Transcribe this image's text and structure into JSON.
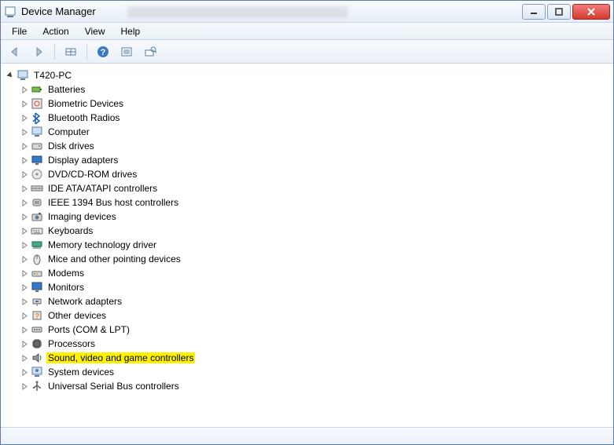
{
  "window": {
    "title": "Device Manager"
  },
  "menus": {
    "file": "File",
    "action": "Action",
    "view": "View",
    "help": "Help"
  },
  "root": {
    "label": "T420-PC"
  },
  "categories": [
    {
      "label": "Batteries",
      "icon": "battery",
      "highlighted": false
    },
    {
      "label": "Biometric Devices",
      "icon": "biometric",
      "highlighted": false
    },
    {
      "label": "Bluetooth Radios",
      "icon": "bluetooth",
      "highlighted": false
    },
    {
      "label": "Computer",
      "icon": "computer",
      "highlighted": false
    },
    {
      "label": "Disk drives",
      "icon": "disk",
      "highlighted": false
    },
    {
      "label": "Display adapters",
      "icon": "display",
      "highlighted": false
    },
    {
      "label": "DVD/CD-ROM drives",
      "icon": "dvd",
      "highlighted": false
    },
    {
      "label": "IDE ATA/ATAPI controllers",
      "icon": "ide",
      "highlighted": false
    },
    {
      "label": "IEEE 1394 Bus host controllers",
      "icon": "ieee1394",
      "highlighted": false
    },
    {
      "label": "Imaging devices",
      "icon": "imaging",
      "highlighted": false
    },
    {
      "label": "Keyboards",
      "icon": "keyboard",
      "highlighted": false
    },
    {
      "label": "Memory technology driver",
      "icon": "memory",
      "highlighted": false
    },
    {
      "label": "Mice and other pointing devices",
      "icon": "mouse",
      "highlighted": false
    },
    {
      "label": "Modems",
      "icon": "modem",
      "highlighted": false
    },
    {
      "label": "Monitors",
      "icon": "monitor",
      "highlighted": false
    },
    {
      "label": "Network adapters",
      "icon": "network",
      "highlighted": false
    },
    {
      "label": "Other devices",
      "icon": "other",
      "highlighted": false
    },
    {
      "label": "Ports (COM & LPT)",
      "icon": "port",
      "highlighted": false
    },
    {
      "label": "Processors",
      "icon": "cpu",
      "highlighted": false
    },
    {
      "label": "Sound, video and game controllers",
      "icon": "sound",
      "highlighted": true
    },
    {
      "label": "System devices",
      "icon": "system",
      "highlighted": false
    },
    {
      "label": "Universal Serial Bus controllers",
      "icon": "usb",
      "highlighted": false
    }
  ]
}
